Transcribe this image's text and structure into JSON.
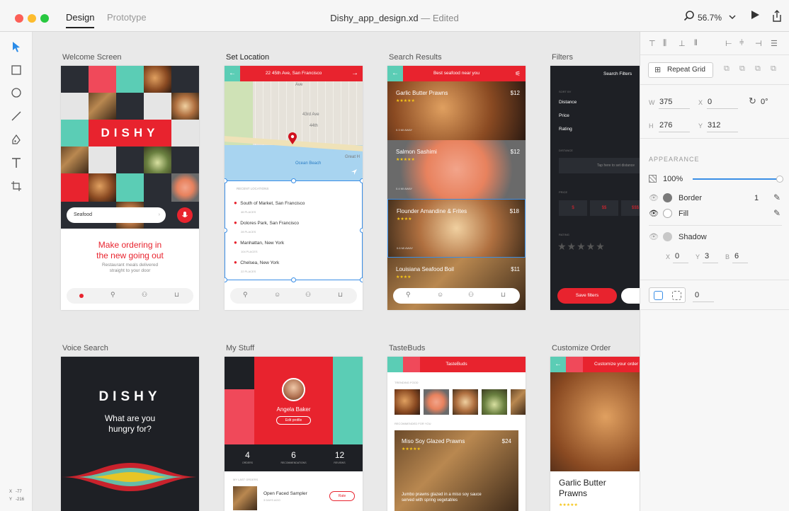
{
  "window": {
    "tabs": [
      {
        "label": "Design"
      },
      {
        "label": "Prototype"
      }
    ],
    "doc_title": "Dishy_app_design.xd",
    "edited_suffix": " — Edited",
    "zoom": "56.7%"
  },
  "toolbar": {
    "coords": {
      "x_label": "X",
      "x_value": "-77",
      "y_label": "Y",
      "y_value": "-216"
    }
  },
  "artboards": {
    "welcome": {
      "label": "Welcome Screen",
      "logo": "DISHY",
      "search_placeholder": "Seafood",
      "headline_line1": "Make ordering in",
      "headline_line2": "the new going out",
      "sub_line1": "Restaurant meals delivered",
      "sub_line2": "straight to your door"
    },
    "set_location": {
      "label": "Set Location",
      "address": "22 45th Ave, San Francisco",
      "map_labels": [
        "Ave",
        "43rd Ave",
        "44th",
        "Ocean Beach",
        "Great H"
      ],
      "list_header": "RECENT LOCATIONS",
      "locations": [
        {
          "name": "South of Market, San Francisco",
          "count": "46 PLACES"
        },
        {
          "name": "Dolores Park, San Francisco",
          "count": "28 PLACES"
        },
        {
          "name": "Manhattan, New York",
          "count": "104 PLACES"
        },
        {
          "name": "Chelsea, New York",
          "count": "22 PLACES"
        }
      ]
    },
    "search_results": {
      "label": "Search Results",
      "header": "Best seafood near you",
      "items": [
        {
          "name": "Garlic Butter Prawns",
          "price": "$12",
          "stars": "★★★★★",
          "distance": "0.3 MI AWAY"
        },
        {
          "name": "Salmon Sashimi",
          "price": "$12",
          "stars": "★★★★★",
          "distance": "0.4 MI AWAY"
        },
        {
          "name": "Flounder Amandine & Frites",
          "price": "$18",
          "stars": "★★★★",
          "distance": "0.6 MI AWAY"
        },
        {
          "name": "Louisiana Seafood Boil",
          "price": "$11",
          "stars": "★★★★",
          "distance": ""
        }
      ]
    },
    "filters": {
      "label": "Filters",
      "header": "Search Filters",
      "sort_label": "SORT BY",
      "sort_options": [
        "Distance",
        "Price",
        "Rating"
      ],
      "distance_label": "DISTANCE",
      "distance_hint": "Tap here to set distance",
      "price_label": "PRICE",
      "price_options": [
        "$",
        "$$",
        "$$$"
      ],
      "rating_label": "RATING",
      "stars": "★★★★★",
      "save_label": "Save filters"
    },
    "voice": {
      "label": "Voice Search",
      "logo": "DISHY",
      "prompt_line1": "What are you",
      "prompt_line2": "hungry for?"
    },
    "mystuff": {
      "label": "My Stuff",
      "user": "Angela Baker",
      "edit_label": "Edit profile",
      "stats": [
        {
          "value": "4",
          "label": "ORDERS"
        },
        {
          "value": "6",
          "label": "RECOMMENDATIONS"
        },
        {
          "value": "12",
          "label": "REVIEWS"
        }
      ],
      "orders_header": "MY LAST ORDERS",
      "order_name": "Open Faced Sampler",
      "order_date": "3 DAYS AGO",
      "rate_label": "Rate"
    },
    "tastebuds": {
      "label": "TasteBuds",
      "header": "TasteBuds",
      "trending": "TRENDING FOOD",
      "recommended": "RECOMMENDED FOR YOU",
      "card_name": "Miso Soy Glazed Prawns",
      "card_price": "$24",
      "card_stars": "★★★★★",
      "card_desc_line1": "Jumbo prawns glazed in a miso soy sauce",
      "card_desc_line2": "served with spring vegetables"
    },
    "customize": {
      "label": "Customize Order",
      "header": "Customize your order",
      "title_line1": "Garlic Butter",
      "title_line2": "Prawns",
      "stars": "★★★★★"
    }
  },
  "panel": {
    "repeat_grid": "Repeat Grid",
    "w_label": "W",
    "w_value": "375",
    "x_label": "X",
    "x_value": "0",
    "rotation": "0°",
    "h_label": "H",
    "h_value": "276",
    "y_label": "Y",
    "y_value": "312",
    "appearance_label": "APPEARANCE",
    "opacity": "100%",
    "border_label": "Border",
    "border_value": "1",
    "fill_label": "Fill",
    "shadow_label": "Shadow",
    "shadow_x_label": "X",
    "shadow_x": "0",
    "shadow_y_label": "Y",
    "shadow_y": "3",
    "shadow_b_label": "B",
    "shadow_b": "6",
    "radius_value": "0"
  },
  "colors": {
    "accent": "#e8232e",
    "teal": "#5bcdb5",
    "dark": "#1e2025",
    "select": "#3a8ee6"
  }
}
